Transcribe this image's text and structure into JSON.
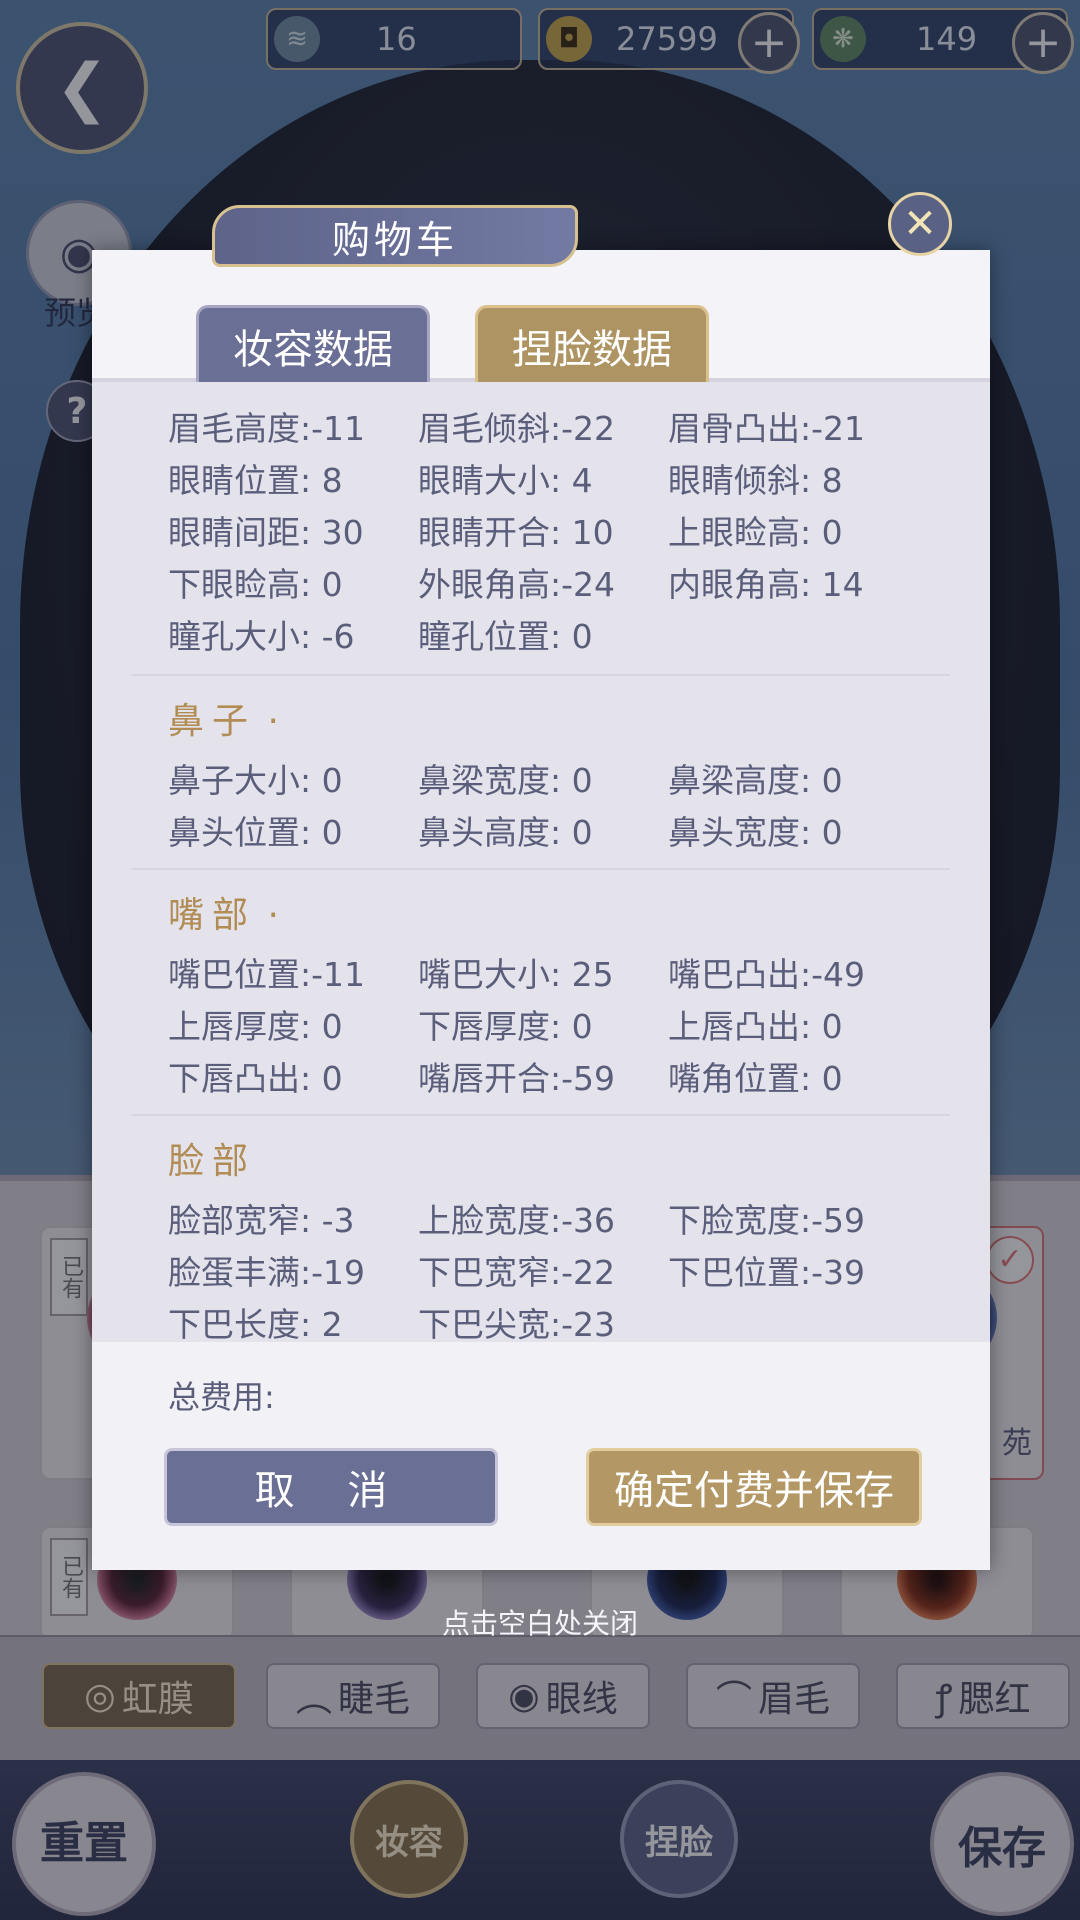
{
  "topbar": {
    "currency1": "16",
    "currency2": "27599",
    "currency3": "149"
  },
  "side": {
    "preview_label": "预览",
    "help_label": "?"
  },
  "modal": {
    "title": "购物车",
    "tabs": [
      "妆容数据",
      "捏脸数据"
    ],
    "rows_top": [
      [
        "眉毛高度:-11",
        "眉毛倾斜:-22",
        "眉骨凸出:-21"
      ],
      [
        "眼睛位置:  8",
        "眼睛大小:  4",
        "眼睛倾斜:  8"
      ],
      [
        "眼睛间距: 30",
        "眼睛开合: 10",
        "上眼睑高:  0"
      ],
      [
        "下眼睑高:  0",
        "外眼角高:-24",
        "内眼角高: 14"
      ],
      [
        "瞳孔大小: -6",
        "瞳孔位置:  0",
        ""
      ]
    ],
    "sections": [
      {
        "title": "鼻子",
        "rows": [
          [
            "鼻子大小:  0",
            "鼻梁宽度:  0",
            "鼻梁高度:  0"
          ],
          [
            "鼻头位置:  0",
            "鼻头高度:  0",
            "鼻头宽度:  0"
          ]
        ]
      },
      {
        "title": "嘴部",
        "rows": [
          [
            "嘴巴位置:-11",
            "嘴巴大小: 25",
            "嘴巴凸出:-49"
          ],
          [
            "上唇厚度:  0",
            "下唇厚度:  0",
            "上唇凸出:  0"
          ],
          [
            "下唇凸出:  0",
            "嘴唇开合:-59",
            "嘴角位置:  0"
          ]
        ]
      },
      {
        "title": "脸部",
        "rows": [
          [
            "脸部宽窄: -3",
            "上脸宽度:-36",
            "下脸宽度:-59"
          ],
          [
            "脸蛋丰满:-19",
            "下巴宽窄:-22",
            "下巴位置:-39"
          ],
          [
            "下巴长度:  2",
            "下巴尖宽:-23",
            ""
          ]
        ]
      }
    ],
    "total_label": "总费用:",
    "cancel_label": "取 消",
    "confirm_label": "确定付费并保存"
  },
  "hint": "点击空白处关闭",
  "bg": {
    "owned_label": "已有",
    "owned_label2": "有",
    "card_side_text": "苑"
  },
  "category_tabs": [
    "虹膜",
    "睫毛",
    "眼线",
    "眉毛",
    "腮红"
  ],
  "bottom": {
    "reset_label": "重置",
    "makeup_label": "妆容",
    "face_label": "捏脸",
    "save_label": "保存"
  }
}
